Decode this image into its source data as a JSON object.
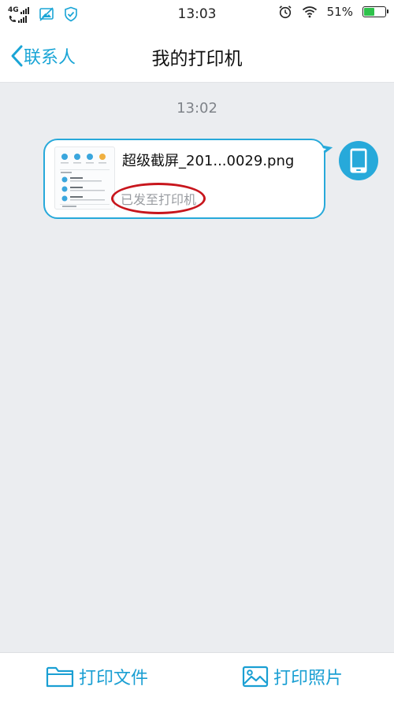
{
  "status_bar": {
    "network_label": "4G",
    "time": "13:03",
    "battery_percent": "51%",
    "battery_level": 0.51,
    "icons": [
      "signal-icon",
      "call-signal-icon",
      "image-icon",
      "shield-check-icon",
      "alarm-icon",
      "wifi-icon",
      "battery-icon"
    ]
  },
  "navbar": {
    "back_label": "联系人",
    "title": "我的打印机"
  },
  "chat": {
    "timestamp": "13:02",
    "message": {
      "file_name": "超级截屏_201...0029.png",
      "status": "已发至打印机",
      "thumb_icon": "screenshot-thumbnail",
      "avatar_icon": "phone-icon"
    }
  },
  "bottom_bar": {
    "print_file_label": "打印文件",
    "print_photo_label": "打印照片"
  },
  "colors": {
    "accent": "#27a9da",
    "annotation_red": "#c8161d",
    "background": "#ebedf0",
    "battery_green": "#2ec24b"
  }
}
